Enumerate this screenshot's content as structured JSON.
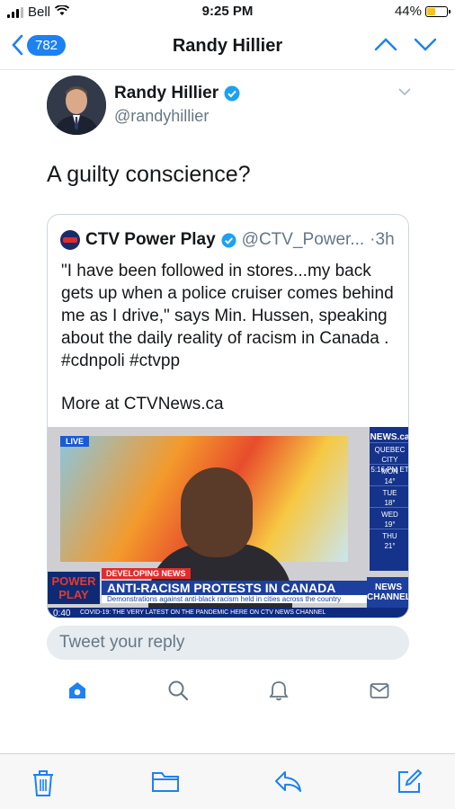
{
  "status_bar": {
    "carrier": "Bell",
    "time": "9:25 PM",
    "battery": "44%",
    "battery_level": 0.44
  },
  "nav": {
    "back_count": "782",
    "title": "Randy Hillier"
  },
  "tweet": {
    "author_name": "Randy Hillier",
    "author_handle": "@randyhillier",
    "text": "A guilty conscience?"
  },
  "quoted_tweet": {
    "author_name": "CTV Power Play",
    "author_handle": "@CTV_Power...",
    "age": "·3h",
    "body": "\"I have been followed in stores...my back gets up when a police cruiser comes behind me as I drive,\" says Min. Hussen, speaking about the daily reality of racism in Canada . #cdnpoli #ctvpp",
    "more": "More at CTVNews.ca",
    "video": {
      "live_label": "LIVE",
      "weather_logo": "NEWS.ca",
      "weather_city": "QUEBEC CITY",
      "weather_time": "5:16 PM ET",
      "forecast": [
        {
          "day": "MON",
          "temp": "14°"
        },
        {
          "day": "TUE",
          "temp": "18°"
        },
        {
          "day": "WED",
          "temp": "19°"
        },
        {
          "day": "THU",
          "temp": "21°"
        }
      ],
      "power_play_logo": "POWER PLAY",
      "developing": "DEVELOPING NEWS",
      "headline": "ANTI-RACISM PROTESTS IN CANADA",
      "subheadline": "Demonstrations against anti-black racism held in cities across the country",
      "channel_logo": "NEWS CHANNEL",
      "ticker": "COVID-19:  THE VERY LATEST ON THE PANDEMIC HERE ON CTV NEWS CHANNEL",
      "timecode": "0:40"
    }
  },
  "reply": {
    "placeholder": "Tweet your reply"
  },
  "icons": {
    "colors": {
      "accent": "#1d81f2",
      "verified": "#1da1f2",
      "muted": "#657786",
      "toolbar": "#1d81f2"
    }
  }
}
